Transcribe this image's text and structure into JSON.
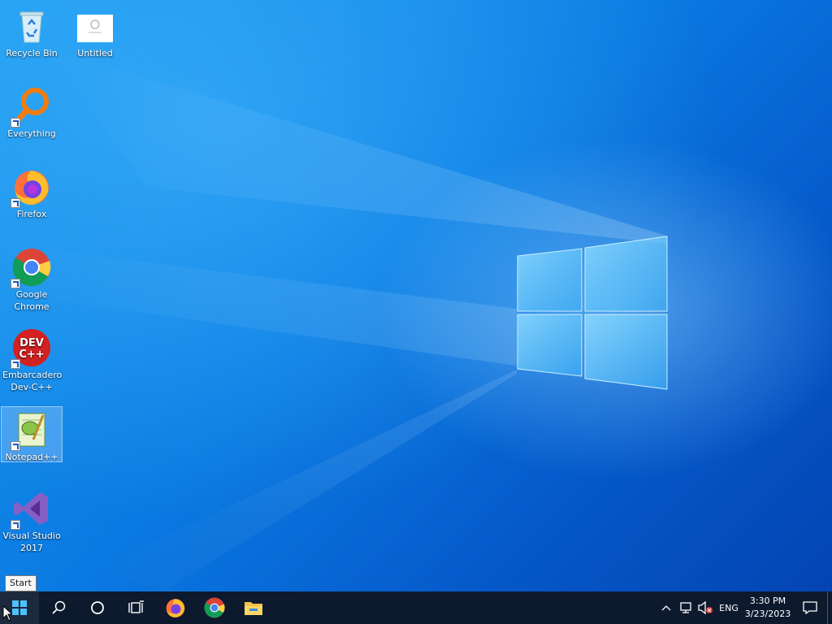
{
  "desktop": {
    "icons": [
      {
        "label": "Recycle Bin"
      },
      {
        "label": "Untitled"
      },
      {
        "label": "Everything"
      },
      {
        "label": "Firefox"
      },
      {
        "label": "Google Chrome"
      },
      {
        "label": "Embarcadero Dev-C++"
      },
      {
        "label": "Notepad++"
      },
      {
        "label": "Visual Studio 2017"
      }
    ],
    "devcpp_logo_text": "DEV\nC++"
  },
  "tooltip": {
    "text": "Start"
  },
  "taskbar": {
    "language": "ENG",
    "clock": {
      "time": "3:30 PM",
      "date": "3/23/2023"
    }
  }
}
